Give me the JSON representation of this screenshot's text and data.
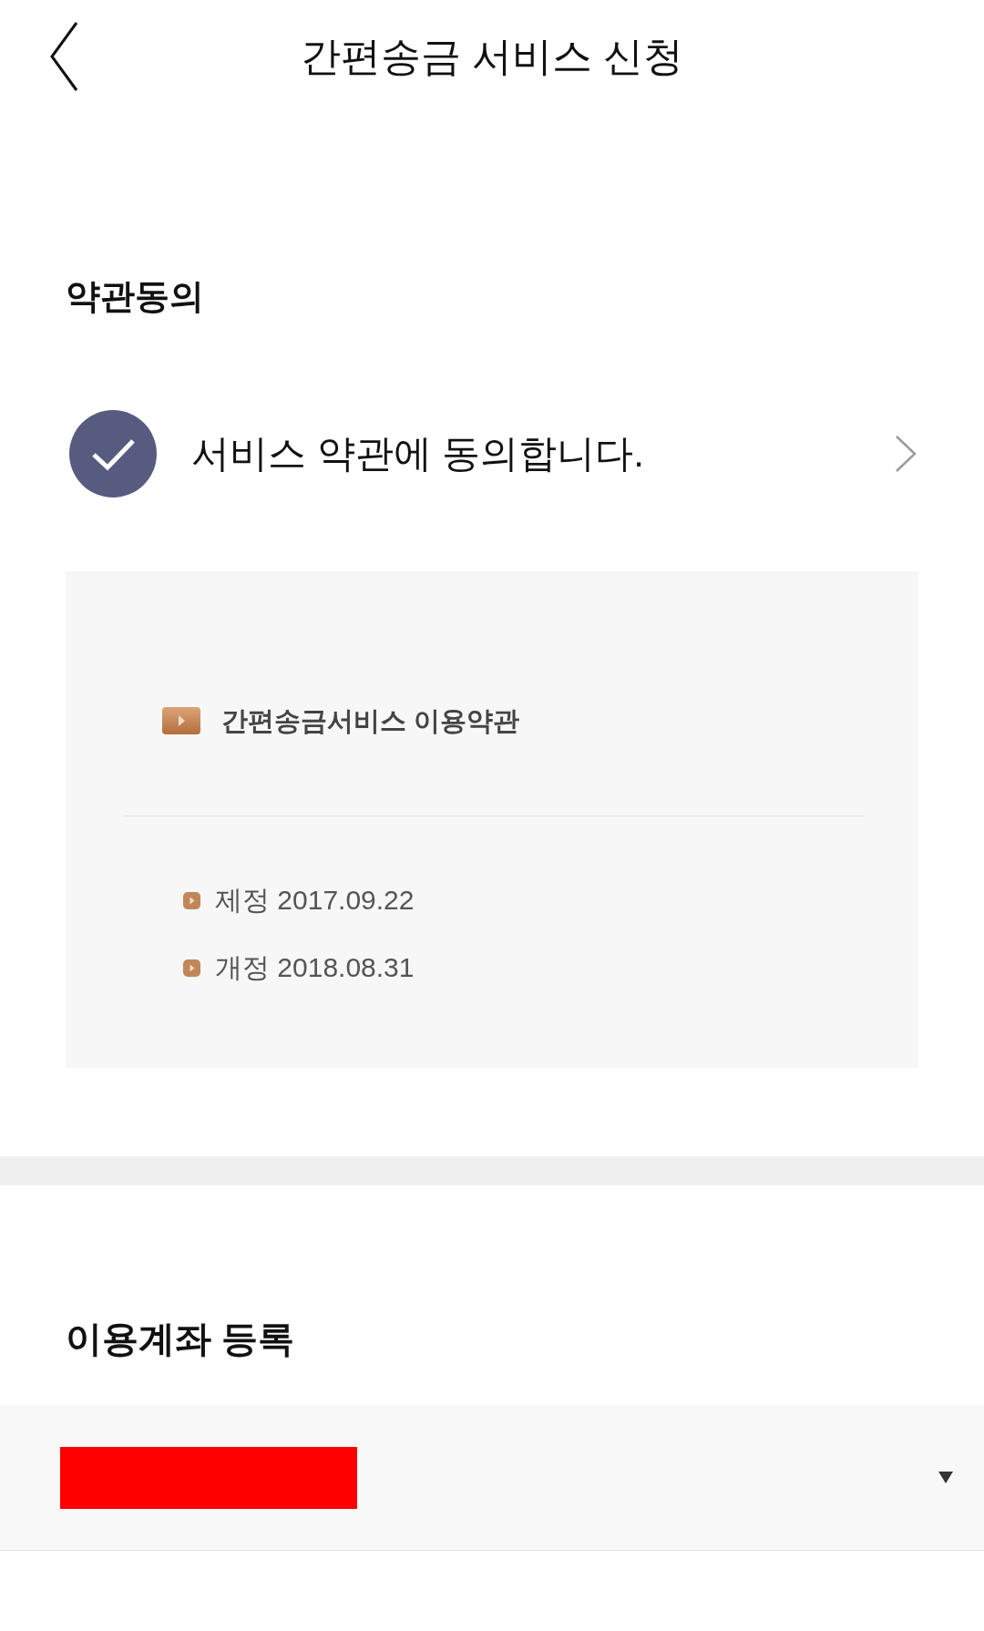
{
  "header": {
    "title": "간편송금 서비스 신청"
  },
  "terms_section": {
    "heading": "약관동의",
    "agreement": {
      "label": "서비스 약관에 동의합니다.",
      "checked": true
    },
    "terms_box": {
      "title": "간편송금서비스 이용약관",
      "dates": [
        "제정 2017.09.22",
        "개정 2018.08.31"
      ]
    }
  },
  "account_section": {
    "heading": "이용계좌 등록"
  }
}
